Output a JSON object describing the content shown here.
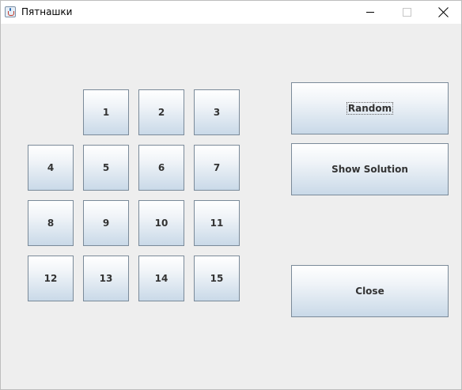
{
  "window": {
    "title": "Пятнашки"
  },
  "tiles": [
    "1",
    "2",
    "3",
    "4",
    "5",
    "6",
    "7",
    "8",
    "9",
    "10",
    "11",
    "12",
    "13",
    "14",
    "15"
  ],
  "buttons": {
    "random": "Random",
    "show_solution": "Show Solution",
    "close": "Close"
  }
}
